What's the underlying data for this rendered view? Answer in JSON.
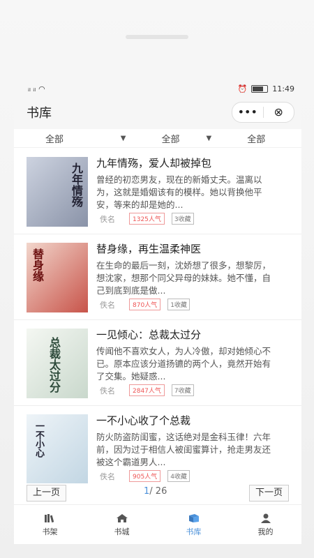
{
  "status": {
    "signal": "ᴴᴰᵒᴸ ᴴᴰᵒᴸ",
    "time": "11:49"
  },
  "header": {
    "title": "书库",
    "menu_label": "•••",
    "close_label": "⊗"
  },
  "filters": [
    "全部",
    "全部",
    "全部"
  ],
  "books": [
    {
      "title": "九年情殇，爱人却被掉包",
      "desc": "曾经的初恋男友，现在的新婚丈夫。温离以为，这就是婚姻该有的模样。她以背换他平安，等来的却是她的...",
      "author": "佚名",
      "popularity": "1325人气",
      "favorites": "3收藏",
      "cover_text": "九年情殇",
      "cover_bg": "#d9dde8"
    },
    {
      "title": "替身缘，再生温柔神医",
      "desc": "在生命的最后一刻，沈娇想了很多，想黎厉，想沈家，想那个同父异母的妹妹。她不懂，自己到底到底是做...",
      "author": "佚名",
      "popularity": "870人气",
      "favorites": "1收藏",
      "cover_text": "替身缘",
      "cover_bg": "#e8c7c0"
    },
    {
      "title": "一见倾心：总裁太过分",
      "desc": "传闻他不喜欢女人，为人冷傲，却对她倾心不已。原本应该分道扬镳的两个人，竟然开始有了交集。她疑惑...",
      "author": "佚名",
      "popularity": "2847人气",
      "favorites": "7收藏",
      "cover_text": "总裁太过分",
      "cover_bg": "#e9efe9"
    },
    {
      "title": "一不小心收了个总裁",
      "desc": "防火防盗防闺蜜，这话绝对是金科玉律！六年前，因为过于相信人被闺蜜算计，抢走男友还被这个霸道男人...",
      "author": "佚名",
      "popularity": "905人气",
      "favorites": "4收藏",
      "cover_text": "一不小心",
      "cover_bg": "#eaf1f6"
    }
  ],
  "pager": {
    "prev": "上一页",
    "next": "下一页",
    "current": "1",
    "total": "/ 26"
  },
  "tabs": [
    {
      "label": "书架",
      "icon": "books-icon"
    },
    {
      "label": "书城",
      "icon": "home-icon"
    },
    {
      "label": "书库",
      "icon": "library-icon"
    },
    {
      "label": "我的",
      "icon": "user-icon"
    }
  ],
  "colors": {
    "accent": "#4a90d9",
    "popularity": "#e55555"
  }
}
